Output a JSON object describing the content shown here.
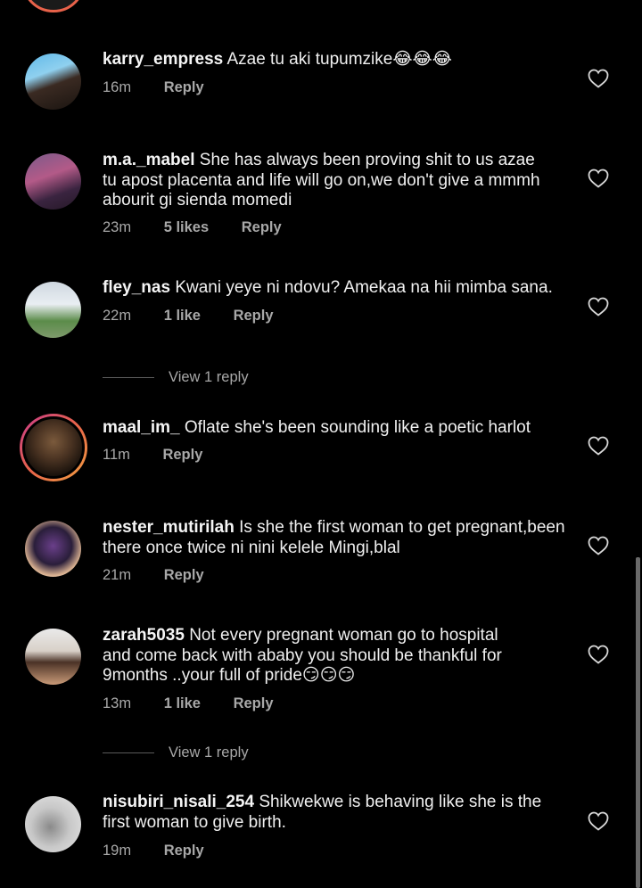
{
  "comments": [
    {
      "username": "karry_empress",
      "text": "Azae tu aki tupumzike😂😂😂",
      "time": "16m",
      "likes": "",
      "reply_label": "Reply"
    },
    {
      "username": "m.a._mabel",
      "text": "She has always been proving shit to us azae tu apost placenta and life will go on,we don't give a mmmh abourit gi sienda momedi",
      "time": "23m",
      "likes": "5 likes",
      "reply_label": "Reply"
    },
    {
      "username": "fley_nas",
      "text": "Kwani yeye ni ndovu? Amekaa na hii  mimba sana.",
      "time": "22m",
      "likes": "1 like",
      "reply_label": "Reply",
      "view_replies": "View 1 reply"
    },
    {
      "username": "maal_im_",
      "text": "Oflate she's been sounding like a poetic harlot",
      "time": "11m",
      "likes": "",
      "reply_label": "Reply"
    },
    {
      "username": "nester_mutirilah",
      "text": "Is she the first woman to get pregnant,been there once twice ni nini kelele Mingi,blal",
      "time": "21m",
      "likes": "",
      "reply_label": "Reply"
    },
    {
      "username": "zarah5035",
      "text": "Not every pregnant woman go to hospital and come back with ababy you should be thankful for 9months ..your full of pride😏😏😏",
      "time": "13m",
      "likes": "1 like",
      "reply_label": "Reply",
      "view_replies": "View 1 reply"
    },
    {
      "username": "nisubiri_nisali_254",
      "text": "Shikwekwe is behaving like she is the first woman to give birth.",
      "time": "19m",
      "likes": "",
      "reply_label": "Reply"
    }
  ],
  "icons": {
    "like": "heart-icon"
  },
  "colors": {
    "background": "#000000",
    "text": "#f0f0f0",
    "meta": "#a8a8a8",
    "story_ring": "#e8644a"
  }
}
